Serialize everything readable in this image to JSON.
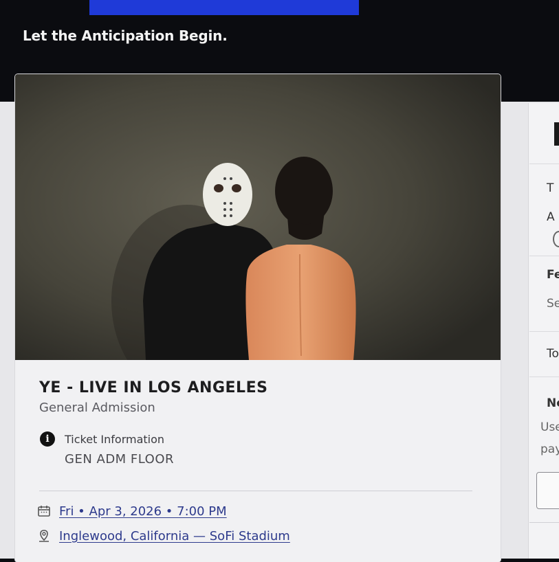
{
  "tagline": "Let the Anticipation Begin.",
  "event": {
    "title": "YE - LIVE IN LOS ANGELES",
    "admission": "General Admission",
    "ticket_info_label": "Ticket Information",
    "ticket_info_value": "GEN ADM FLOOR",
    "date_link": "Fri • Apr 3, 2026 • 7:00 PM",
    "venue_link": "Inglewood, California — SoFi Stadium"
  },
  "side_panel": {
    "labels": [
      "T",
      "A",
      "Fe",
      "Se",
      "To",
      "Ne",
      "Use",
      "pay"
    ]
  },
  "icons": {
    "info": "info-icon",
    "calendar": "calendar-icon",
    "location": "location-pin-icon"
  },
  "colors": {
    "link": "#2d3a8c",
    "banner": "#1f3ad8"
  }
}
